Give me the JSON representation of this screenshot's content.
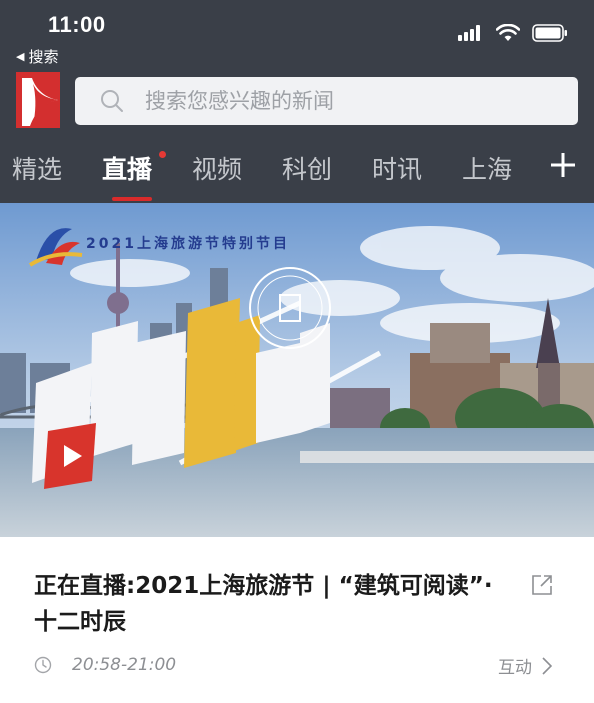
{
  "status_bar": {
    "time": "11:00"
  },
  "nav": {
    "back_label": "搜索"
  },
  "search": {
    "placeholder": "搜索您感兴趣的新闻"
  },
  "tabs": [
    {
      "label": "精选",
      "active": false
    },
    {
      "label": "直播",
      "active": true,
      "badge": "red-dot"
    },
    {
      "label": "视频",
      "active": false
    },
    {
      "label": "科创",
      "active": false
    },
    {
      "label": "时讯",
      "active": false
    },
    {
      "label": "上海",
      "active": false
    }
  ],
  "banner": {
    "subtitle": "2021上海旅游节特别节目",
    "title_art": "“建筑可阅读”·十二时辰"
  },
  "article": {
    "title": "正在直播:2021上海旅游节 | “建筑可阅读”·十二时辰",
    "time_range": "20:58-21:00",
    "interact_label": "互动"
  },
  "colors": {
    "header_bg": "#3a3f48",
    "accent_red": "#d92b2b",
    "tab_inactive": "#c4c7cc",
    "meta_gray": "#8d8f93"
  }
}
